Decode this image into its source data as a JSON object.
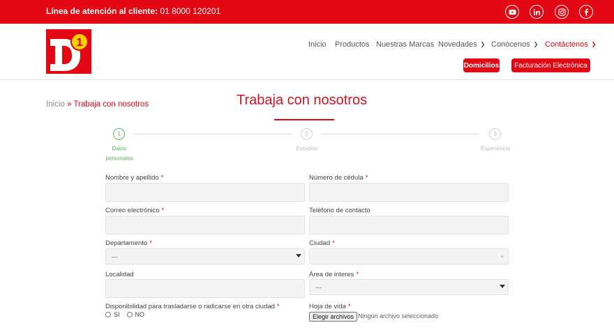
{
  "topbar": {
    "hotline_label": "Línea de atención al cliente:",
    "hotline_number": "01 8000 120201",
    "social": [
      "youtube-icon",
      "linkedin-icon",
      "instagram-icon",
      "facebook-icon"
    ]
  },
  "logo": {
    "letter": "D",
    "number": "1"
  },
  "nav": {
    "items": [
      {
        "label": "Inicio"
      },
      {
        "label": "Productos"
      },
      {
        "label": "Nuestras Marcas"
      },
      {
        "label": "Novedades"
      },
      {
        "label": "Conócenos"
      },
      {
        "label": "Contáctenos"
      }
    ],
    "domicilios": "Domicilios",
    "facturacion": "Facturación Electrónica"
  },
  "breadcrumb": {
    "home": "Inicio",
    "separator": "»",
    "current": "Trabaja con nosotros"
  },
  "page_title": "Trabaja con nosotros",
  "stepper": {
    "steps": [
      {
        "number": "1",
        "label": "Datos personales"
      },
      {
        "number": "2",
        "label": "Estudios"
      },
      {
        "number": "3",
        "label": "Experiencia"
      }
    ],
    "active_step": 1
  },
  "form": {
    "nombre_label": "Nombre y apellido",
    "cedula_label": "Número de cédula",
    "correo_label": "Correo electrónico",
    "telefono_label": "Teléfono de contacto",
    "departamento_label": "Departamento",
    "departamento_value": "---",
    "ciudad_label": "Ciudad",
    "localidad_label": "Localidad",
    "area_label": "Área de interes",
    "area_value": "---",
    "disponibilidad_label": "Disponibilidad para trasladarse o radicarse en otra ciudad",
    "option_si": "SI",
    "option_no": "NO",
    "hoja_label": "Hoja de vida",
    "file_button": "Elegir archivos",
    "file_status": "Ningún archivo seleccionado",
    "required_mark": "*"
  },
  "colors": {
    "brand_red": "#e30613",
    "step_active": "#5cb85c",
    "logo_yellow": "#f6d200"
  }
}
